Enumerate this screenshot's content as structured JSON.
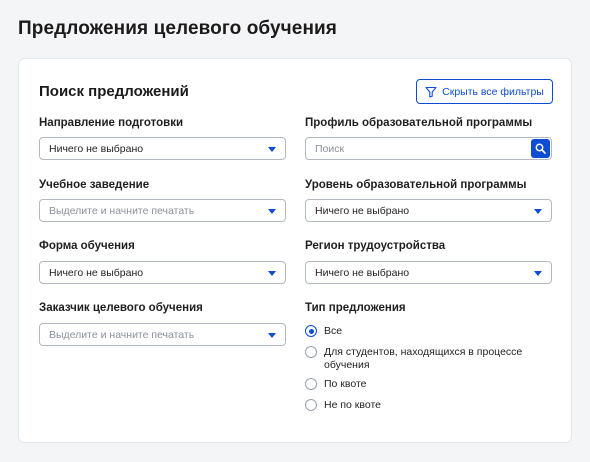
{
  "page": {
    "title": "Предложения целевого обучения"
  },
  "search": {
    "title": "Поиск предложений",
    "hide_filters_label": "Скрыть все фильтры",
    "fields": {
      "direction": {
        "label": "Направление подготовки",
        "value": "Ничего не выбрано"
      },
      "profile": {
        "label": "Профиль образовательной программы",
        "placeholder": "Поиск"
      },
      "institution": {
        "label": "Учебное заведение",
        "placeholder": "Выделите и начните печатать"
      },
      "level": {
        "label": "Уровень образовательной программы",
        "value": "Ничего не выбрано"
      },
      "form": {
        "label": "Форма обучения",
        "value": "Ничего не выбрано"
      },
      "region": {
        "label": "Регион трудоустройства",
        "value": "Ничего не выбрано"
      },
      "customer": {
        "label": "Заказчик целевого обучения",
        "placeholder": "Выделите и начните печатать"
      }
    },
    "offer_type": {
      "label": "Тип предложения",
      "options": [
        {
          "label": "Все",
          "checked": true
        },
        {
          "label": "Для студентов, находящихся в процессе обучения",
          "checked": false
        },
        {
          "label": "По квоте",
          "checked": false
        },
        {
          "label": "Не по квоте",
          "checked": false
        }
      ]
    }
  },
  "colors": {
    "accent": "#0d4cd3",
    "border": "#b3b9c2",
    "background": "#f4f5f7"
  },
  "icons": {
    "filter": "filter-icon",
    "search": "search-icon",
    "dropdown": "chevron-down-icon"
  }
}
